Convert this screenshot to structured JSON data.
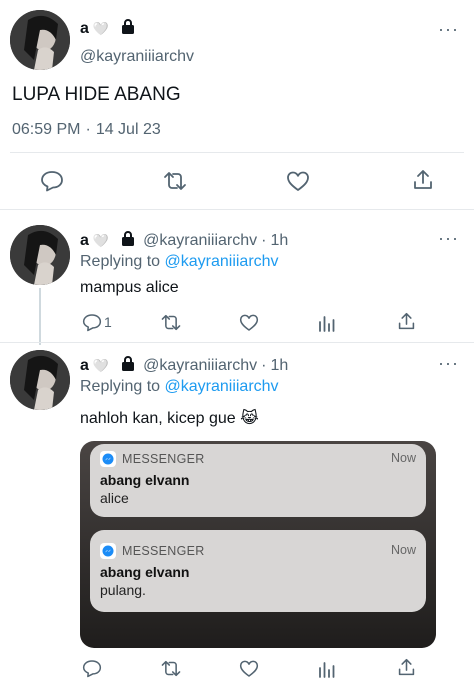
{
  "main_tweet": {
    "name": "a",
    "heart_emoji": "🤍",
    "handle": "@kayraniiiarchv",
    "text": "LUPA HIDE ABANG",
    "time": "06:59 PM",
    "date_separator": "·",
    "date": "14 Jul 23",
    "more": "···"
  },
  "replies": [
    {
      "name": "a",
      "heart_emoji": "🤍",
      "handle": "@kayraniiiarchv",
      "separator": "·",
      "age": "1h",
      "replying_prefix": "Replying to",
      "replying_to": "@kayraniiiarchv",
      "text": "mampus alice",
      "reply_count": "1",
      "more": "···"
    },
    {
      "name": "a",
      "heart_emoji": "🤍",
      "handle": "@kayraniiiarchv",
      "separator": "·",
      "age": "1h",
      "replying_prefix": "Replying to",
      "replying_to": "@kayraniiiarchv",
      "text": "nahloh kan, kicep gue 😹",
      "more": "···"
    }
  ],
  "notifications": [
    {
      "app": "MESSENGER",
      "time": "Now",
      "title": "abang elvann",
      "body": "alice"
    },
    {
      "app": "MESSENGER",
      "time": "Now",
      "title": "abang elvann",
      "body": "pulang."
    }
  ],
  "icons": {
    "reply": "reply-icon",
    "retweet": "retweet-icon",
    "like": "heart-icon",
    "views": "views-icon",
    "share": "share-icon",
    "lock": "lock-icon"
  }
}
